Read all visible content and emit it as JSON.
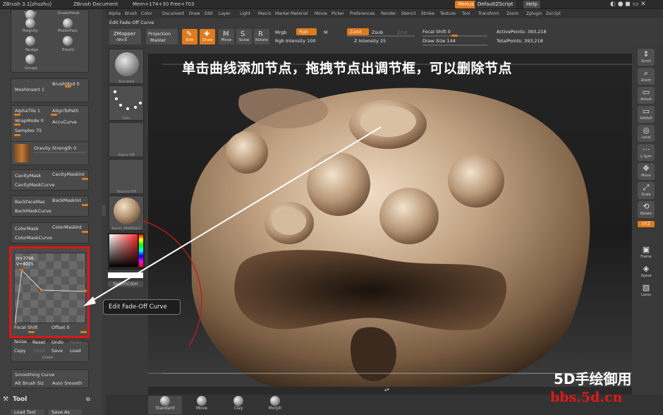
{
  "titlebar": {
    "app": "ZBrush 3.1[zhuzhu]",
    "doc": "ZBrush Document",
    "mem": "Mem+174+30 Free+703",
    "menus_btn": "Menus",
    "script_btn": "DefaultZScript",
    "help_btn": "Help"
  },
  "menubar": [
    "Alpha",
    "Brush",
    "Color",
    "Document",
    "Draw",
    "Edit",
    "Layer",
    "Light",
    "Macro",
    "Marker",
    "Material",
    "Movie",
    "Picker",
    "Preferences",
    "Render",
    "Stencil",
    "Stroke",
    "Texture",
    "Tool",
    "Transform",
    "Zoom",
    "Zplugin",
    "Zscript"
  ],
  "toolbar": {
    "title": "Edit Fade-Off Curve",
    "zmapper": "ZMapper",
    "zmapper_sub": "rev-E",
    "projection": "Projection",
    "projection_sub": "Master",
    "edit": "Edit",
    "draw": "Draw",
    "move": "Move",
    "scale": "Scale",
    "rotate": "Rotate",
    "mrgb": "Mrgb",
    "rgb": "Rgb",
    "m": "M",
    "rgb_intensity": "Rgb Intensity 100",
    "zadd": "Zadd",
    "zsub": "Zsub",
    "zcut": "Zcut",
    "z_intensity": "Z Intensity 25",
    "focal_shift": "Focal Shift 0",
    "draw_size": "Draw Size 144",
    "active_points": "ActivePoints: 393,218",
    "total_points": "TotalPoints: 393,218"
  },
  "leftpanel": {
    "brushes": [
      "Slash1",
      "SnakeHook",
      "Magnify",
      "MalletFast",
      "Nudge",
      "Elastic",
      "Gouge"
    ],
    "meshinsert": "MeshInsert 1",
    "brushmod": "BrushMod 0",
    "alphatile": "AlphaTile 1",
    "aligntopath": "AlignToPath",
    "wrapmode": "WrapMode 0",
    "accucurve": "AccuCurve",
    "samples": "Samples 75",
    "gravity": "Gravity Strength 0",
    "cavitymask": "CavityMask",
    "cavitymaskint": "CavityMaskInt",
    "cavitymaskcurve": "CavityMaskCurve",
    "backfacemask": "BackfaceMas",
    "backmaskint": "BackMaskInt",
    "backmaskcurve": "BackMaskCurve",
    "colormask": "ColorMask",
    "colormaskint": "ColorMaskInt",
    "colormaskcurve": "ColorMaskCurve",
    "curve_h": "H+3766",
    "curve_v": "V+4935",
    "focal_shift": "Focal Shift",
    "offset": "Offset 0",
    "noise": "Noise",
    "reset": "Reset",
    "undo": "Undo",
    "redo": "Redo",
    "copy": "Copy",
    "paste": "Paste",
    "save": "Save",
    "load": "Load",
    "close": "Close",
    "smoothing_curve": "Smoothing Curve",
    "alt_brush": "Alt Brush Siz",
    "auto_smooth": "Auto Smooth",
    "tool_title": "Tool",
    "load_tool": "Load Tool",
    "save_as": "Save As"
  },
  "midpanel": [
    "Standard",
    "Dots",
    "Alpha Off",
    "Texture Off",
    "Aaron_MatBlob2",
    "SwitchColor"
  ],
  "rightpanel": [
    "Scroll",
    "Zoom",
    "Actual",
    "AAHalf",
    "Local",
    "L.Sym",
    "Move",
    "Scale",
    "Rotate",
    "Frame",
    "Xpose",
    "Lasso"
  ],
  "rightpanel_xyz": "XYZ",
  "bottombar": [
    "Standard",
    "Move",
    "Clay",
    "Morph"
  ],
  "annotation": "单击曲线添加节点，拖拽节点出调节框，可以删除节点",
  "tooltip": "Edit Fade-Off Curve",
  "watermark_cn": "5D手绘御用",
  "watermark_url": "bbs.5d.cn",
  "colors": {
    "accent": "#e07a1c",
    "highlight_box": "#e01515",
    "panel": "#3f3f3f"
  }
}
